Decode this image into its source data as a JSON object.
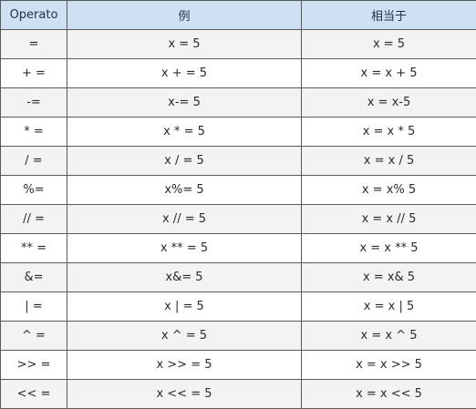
{
  "table": {
    "headers": [
      "Operato",
      "例",
      "相当于"
    ],
    "rows": [
      [
        "=",
        "x = 5",
        "x = 5"
      ],
      [
        "+ =",
        "x + = 5",
        "x = x + 5"
      ],
      [
        "-=",
        "x-= 5",
        "x = x-5"
      ],
      [
        "* =",
        "x * = 5",
        "x = x * 5"
      ],
      [
        "/ =",
        "x / = 5",
        "x = x / 5"
      ],
      [
        "%=",
        "x%= 5",
        "x = x% 5"
      ],
      [
        "// =",
        "x // = 5",
        "x = x // 5"
      ],
      [
        "** =",
        "x ** = 5",
        "x = x ** 5"
      ],
      [
        "&=",
        "x&= 5",
        "x = x& 5"
      ],
      [
        "| =",
        "x | = 5",
        "x = x | 5"
      ],
      [
        "^ =",
        "x ^ = 5",
        "x = x ^ 5"
      ],
      [
        ">> =",
        "x >> = 5",
        "x = x >> 5"
      ],
      [
        "<< =",
        "x << = 5",
        "x = x << 5"
      ]
    ]
  }
}
